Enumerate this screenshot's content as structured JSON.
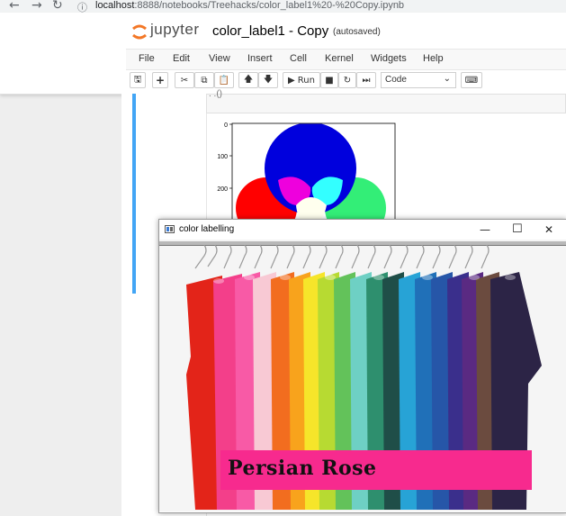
{
  "browser": {
    "url_host": "localhost",
    "url_path": ":8888/notebooks/Treehacks/color_label1%20-%20Copy.ipynb"
  },
  "header": {
    "logo_text": "jupyter",
    "notebook_name": "color_label1 - Copy",
    "save_status": "(autosaved)"
  },
  "menubar": {
    "items": [
      "File",
      "Edit",
      "View",
      "Insert",
      "Cell",
      "Kernel",
      "Widgets",
      "Help"
    ]
  },
  "toolbar": {
    "run_label": "Run",
    "cell_type": "Code"
  },
  "plot": {
    "yticks": [
      "0",
      "100",
      "200"
    ]
  },
  "cv_window": {
    "title": "color labelling",
    "detected_color_name": "Persian Rose",
    "label_bg": "#f72a8e"
  },
  "colors": {
    "cell_bar": "#42a5f5"
  }
}
